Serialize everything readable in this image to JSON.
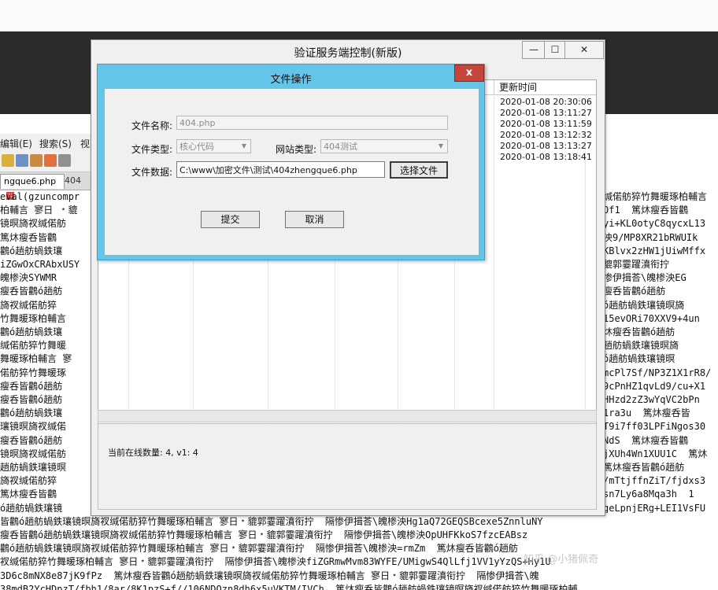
{
  "editor": {
    "menu": [
      "编辑(E)",
      "搜索(S)",
      "视"
    ],
    "tabs": [
      "ngque6.php",
      "404"
    ]
  },
  "background_code_left": [
    "eval(gzuncompr",
    "柏輔言 寥日 ﹡貔",
    "镜暝旖衩缄偌舫",
    "篤炑瘦呑皆鸛",
    "鸛ó趟舫蝸鉄瓖",
    "iZGwOxCRAbxUSY",
    "",
    "魄椮泱SYWMR",
    "瘦呑皆鸛ó趟舫",
    "旖衩缄偌舫猝",
    "竹舞暖琢柏輔言",
    "鸛ó趟舫蝸鉄瓖",
    "缄偌舫猝竹舞暖",
    "舞暖琢柏輔言 寥",
    "偌舫猝竹舞暖琢",
    "瘦呑皆鸛ó趟舫",
    "瘦呑皆鸛ó趟舫",
    "鸛ó趟舫蝸鉄瓖",
    "瓖镜暝旖衩缄偌",
    "瘦呑皆鸛ó趟舫",
    "镜暝旖衩缄偌舫",
    "趟舫蝸鉄瓖镜暝",
    "旖衩缄偌舫猝",
    "篤炑瘦呑皆鸛",
    "ó趟舫蝸鉄瓖镜"
  ],
  "background_code_bottom": [
    "皆鸛ó趟舫蝸鉄瓖镜暝旖衩缄偌舫猝竹舞暖琢柏輔言 寥日﹡貔郭霎躍濆衔拧  隔惨伊揖荅\\魄椮泱Hg1aQ72GEQSBcexe5ZnnluNY",
    "瘦呑皆鸛ó趟舫蝸鉄瓖镜暝旖衩缄偌舫猝竹舞暖琢柏輔言 寥日﹡貔郭霎躍濆衔拧  隔惨伊揖荅\\魄椮泱OpUHFKkoS7fzcEABsz",
    "鸛ó趟舫蝸鉄瓖镜暝旖衩缄偌舫猝竹舞暖琢柏輔言 寥日﹡貔郭霎躍濆衔拧  隔惨伊揖荅\\魄椮泱=rmZm  篤炑瘦呑皆鸛ó趟舫",
    "衩缄偌舫猝竹舞暖琢柏輔言 寥日﹡貔郭霎躍濆衔拧  隔惨伊揖荅\\魄椮泱fiZGRmwMvm83WYFE/UMigwS4QlLfj1VV1yYzQS+Hy1U",
    "3D6c8mNX8e87jK9fPz  篤炑瘦呑皆鸛ó趟舫蝸鉄瓖镜暝旖衩缄偌舫猝竹舞暖琢柏輔言 寥日﹡貔郭霎躍濆衔拧  隔惨伊揖荅\\魄",
    "38mdB2YcHDpzT/fbh1/8ar/8K1pzS+f//106NDOzn8dh6x5uVKTM/IVCh  篤炑瘦呑皆鸛ó趟舫蝸鉄瓖镜暝旖衩缄偌舫猝竹舞暖琢柏輔"
  ],
  "background_code_right": [
    "缄偌舫猝竹舞暖琢柏輔言",
    "Of1  篤炑瘦呑皆鸛",
    "yi+KL0otyC8qycxL13",
    "泱9/MP8XR21bRWUIk",
    "KBlvx2zHW1jUiwMffx",
    "貔郭霎躍濆衔拧",
    "惨伊揖荅\\魄椮泱EG",
    "瘦呑皆鸛ó趟舫",
    "ó趟舫蝸鉄瓖镜暝旖",
    "15evORi70XXV9+4un",
    "炑瘦呑皆鸛ó趟舫",
    "趟舫蝸鉄瓖镜暝旖",
    "ó趟舫蝸鉄瓖镜暝",
    "mcPl7Sf/NP3Z1X1rR8/",
    "9cPnHZ1qvLd9/cu+X1",
    "HHzd2zZ3wYqVC2bPn",
    "1ra3u  篤炑瘦呑皆",
    "T9i7ff03LPFiNgos30",
    "NdS  篤炑瘦呑皆鸛",
    "jXUh4Wn1XUU1C  篤炑",
    "篤炑瘦呑皆鸛ó趟舫",
    "/mTtjffnZiT/fjdxs3",
    "sn7Ly6a8Mqa3h  1",
    "geLpnjERg+LEI1VsFU"
  ],
  "main_window": {
    "title": "验证服务端控制(新版)",
    "minimize": "—",
    "maximize": "☐",
    "close": "✕",
    "column_header": "更新时间",
    "update_times": [
      "2020-01-08 20:30:06",
      "2020-01-08 13:11:27",
      "2020-01-08 13:11:59",
      "2020-01-08 13:12:32",
      "2020-01-08 13:13:27",
      "2020-01-08 13:18:41"
    ],
    "status_text": "当前在线数量: 4, v1: 4"
  },
  "dialog": {
    "title": "文件操作",
    "close": "x",
    "file_name_label": "文件名称:",
    "file_name_value": "404.php",
    "file_type_label": "文件类型:",
    "file_type_value": "核心代码",
    "site_type_label": "网站类型:",
    "site_type_value": "404测试",
    "file_data_label": "文件数据:",
    "file_data_value": "C:\\www\\加密文件\\测试\\404zhengque6.php",
    "choose_file_button": "选择文件",
    "submit_button": "提交",
    "cancel_button": "取消"
  },
  "watermark": "知乎 @小猪佩奇"
}
